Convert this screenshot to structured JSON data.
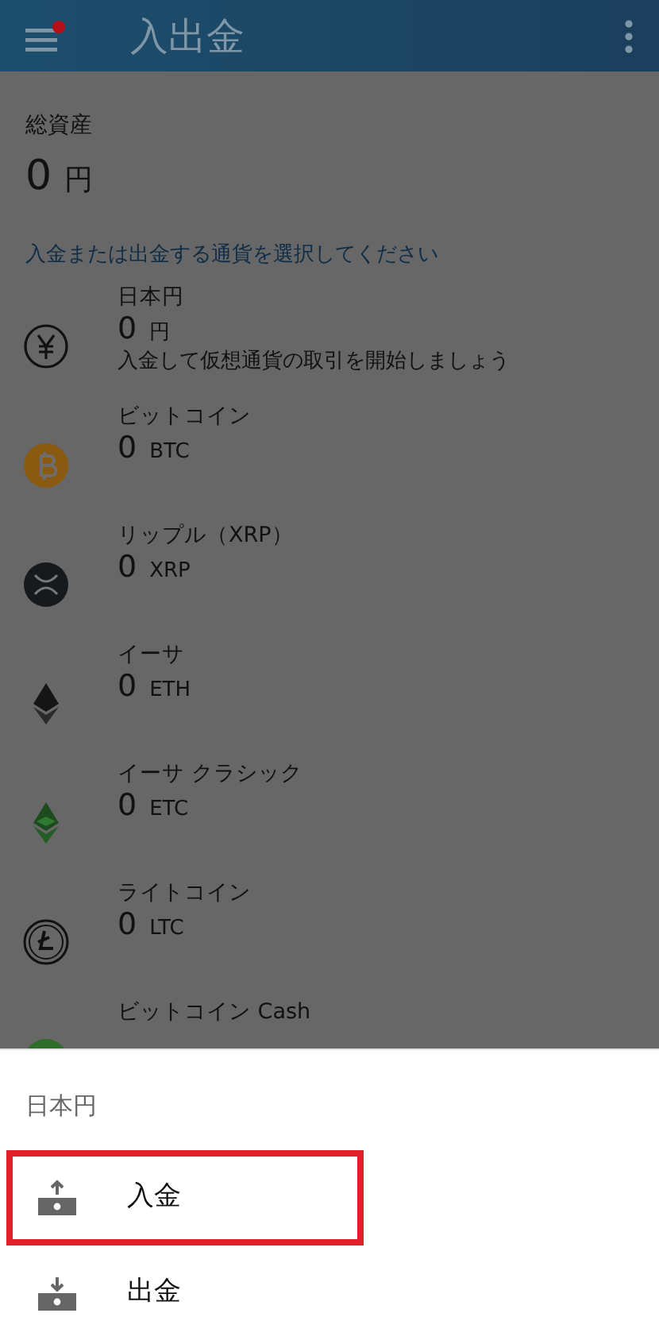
{
  "app_bar": {
    "menu_badge": true,
    "title": "入出金"
  },
  "total": {
    "label": "総資産",
    "amount": "0",
    "unit": "円"
  },
  "prompt": "入金または出金する通貨を選択してください",
  "currencies": [
    {
      "kind": "yen",
      "name": "日本円",
      "amount": "0",
      "unit": "円",
      "note": "入金して仮想通貨の取引を開始しましょう"
    },
    {
      "kind": "btc",
      "name": "ビットコイン",
      "amount": "0",
      "unit": "BTC"
    },
    {
      "kind": "xrp",
      "name": "リップル（XRP）",
      "amount": "0",
      "unit": "XRP"
    },
    {
      "kind": "eth",
      "name": "イーサ",
      "amount": "0",
      "unit": "ETH"
    },
    {
      "kind": "etc",
      "name": "イーサ クラシック",
      "amount": "0",
      "unit": "ETC"
    },
    {
      "kind": "ltc",
      "name": "ライトコイン",
      "amount": "0",
      "unit": "LTC"
    },
    {
      "kind": "bch",
      "name": "ビットコイン Cash"
    }
  ],
  "sheet": {
    "title": "日本円",
    "actions": [
      {
        "kind": "deposit",
        "label": "入金",
        "highlighted": true
      },
      {
        "kind": "withdraw",
        "label": "出金",
        "highlighted": false
      }
    ]
  }
}
